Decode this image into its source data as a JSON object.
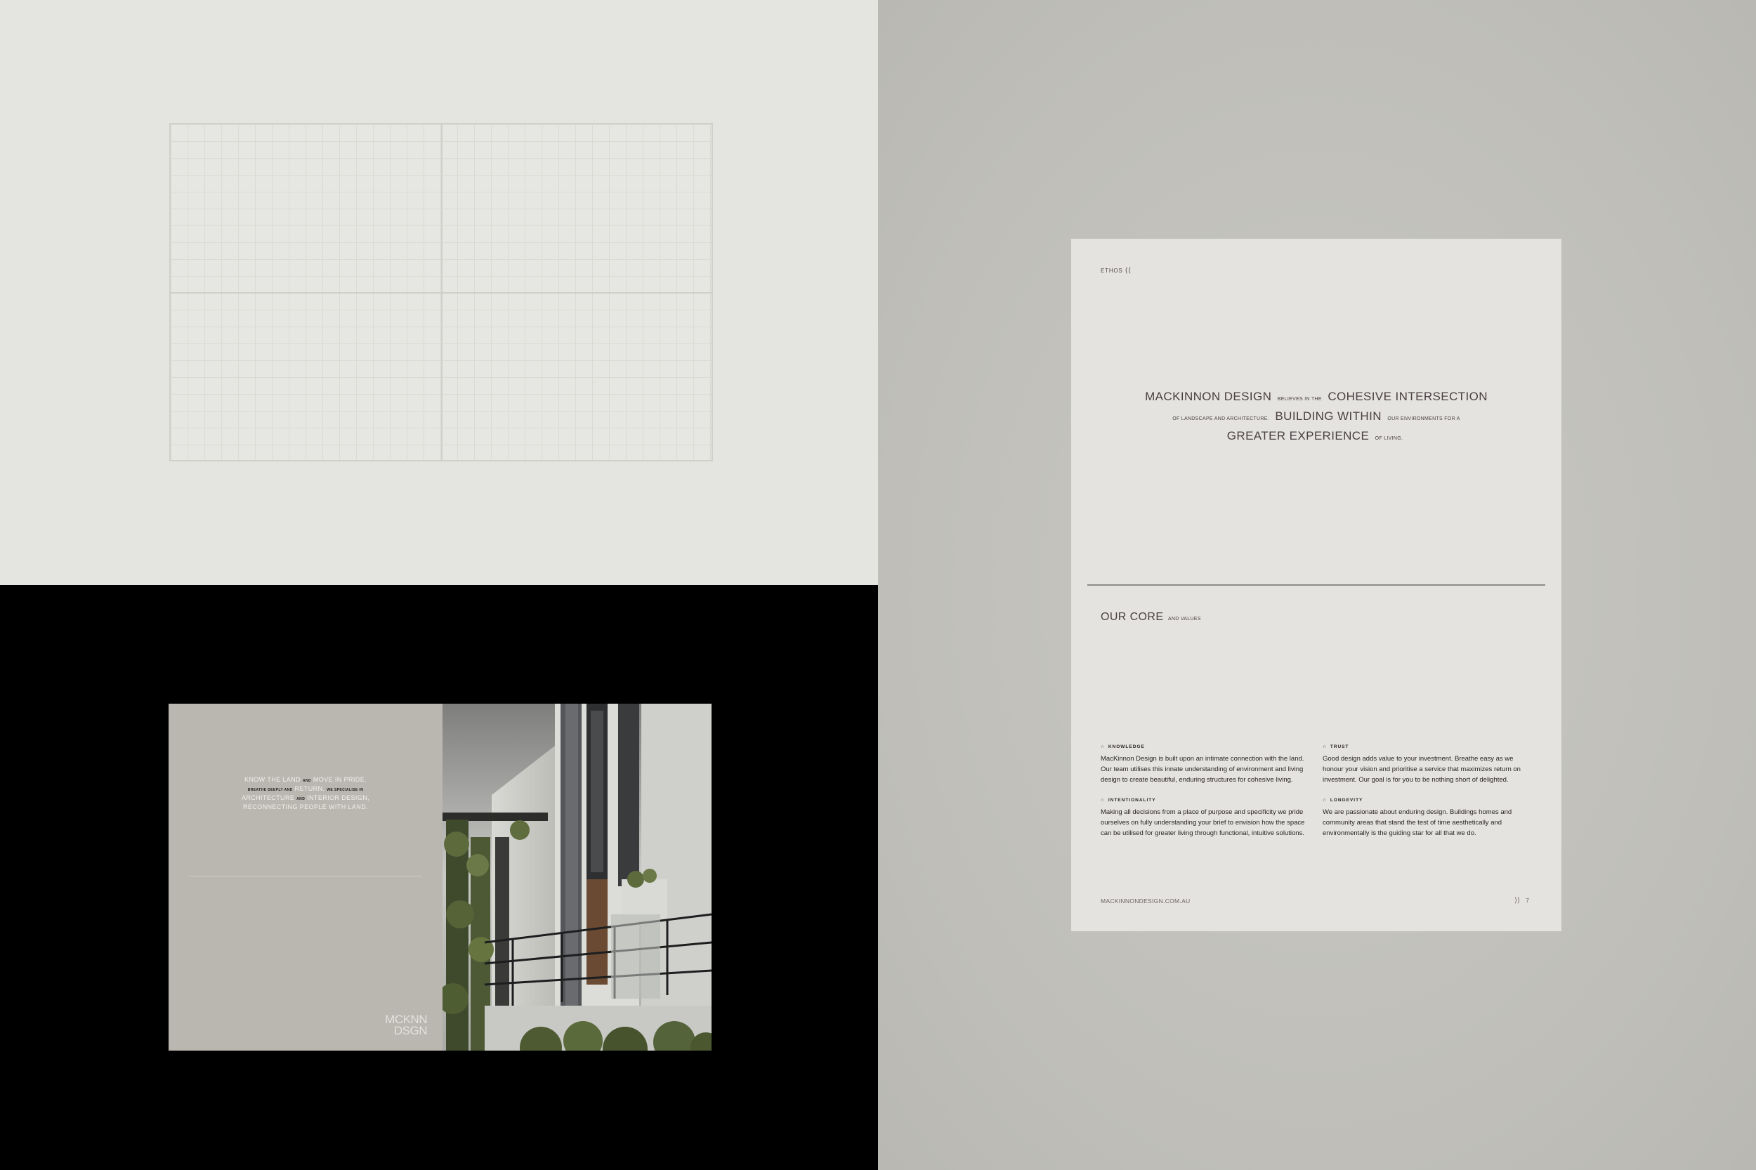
{
  "brochure": {
    "tagline": {
      "p1": "KNOW THE LAND",
      "p2": "AND",
      "p3": "MOVE IN PRIDE.",
      "p4": "BREATHE DEEPLY AND",
      "p5": "RETURN.",
      "p6": "WE SPECIALISE IN",
      "p7": "ARCHITECTURE",
      "p8": "AND",
      "p9": "INTERIOR DESIGN,",
      "p10": "RECONNECTING PEOPLE WITH LAND."
    },
    "logo": {
      "line1": "MCKNN",
      "line2": "DSGN"
    }
  },
  "ethos_page": {
    "label": "ETHOS",
    "label_icon": "double-chevron-left-icon",
    "statement": {
      "s1": "MACKINNON DESIGN",
      "s2": "BELIEVES IN THE",
      "s3": "COHESIVE INTERSECTION",
      "s4": "OF LANDSCAPE AND ARCHITECTURE.",
      "s5": "BUILDING WITHIN",
      "s6": "OUR ENVIRONMENTS FOR A",
      "s7": "GREATER EXPERIENCE",
      "s8": "OF LIVING."
    },
    "core_heading": {
      "main": "OUR CORE",
      "sub": "AND VALUES"
    },
    "values": [
      {
        "title": "KNOWLEDGE",
        "icon": "arch-icon",
        "body": "MacKinnon Design is built upon an intimate connection with the land. Our team utilises this innate understanding of environment and living design to create beautiful, enduring structures for cohesive living."
      },
      {
        "title": "TRUST",
        "icon": "arch-icon",
        "body": "Good design adds value to your investment. Breathe easy as we honour your vision and prioritise a service that maximizes return on investment. Our goal is for you to be nothing short of delighted."
      },
      {
        "title": "INTENTIONALITY",
        "icon": "arch-icon",
        "body": "Making all decisions from a place of purpose and specificity we pride ourselves on fully understanding your brief to envision how the space can be utilised for greater living through functional, intuitive solutions."
      },
      {
        "title": "LONGEVITY",
        "icon": "arch-icon",
        "body": "We are passionate about enduring design. Buildings homes and community areas that stand the test of time aesthetically and environmentally is the guiding star for all that we do."
      }
    ],
    "footer_url": "MACKINNONDESIGN.COM.AU",
    "footer_icon": "double-chevron-right-icon",
    "page_number": "7"
  },
  "colors": {
    "grid_bg": "#e4e5e0",
    "right_bg": "#c2c1bb",
    "page_bg": "#e4e3df",
    "brochure_left": "#b9b7b0",
    "text_plum": "#4a3f43"
  }
}
